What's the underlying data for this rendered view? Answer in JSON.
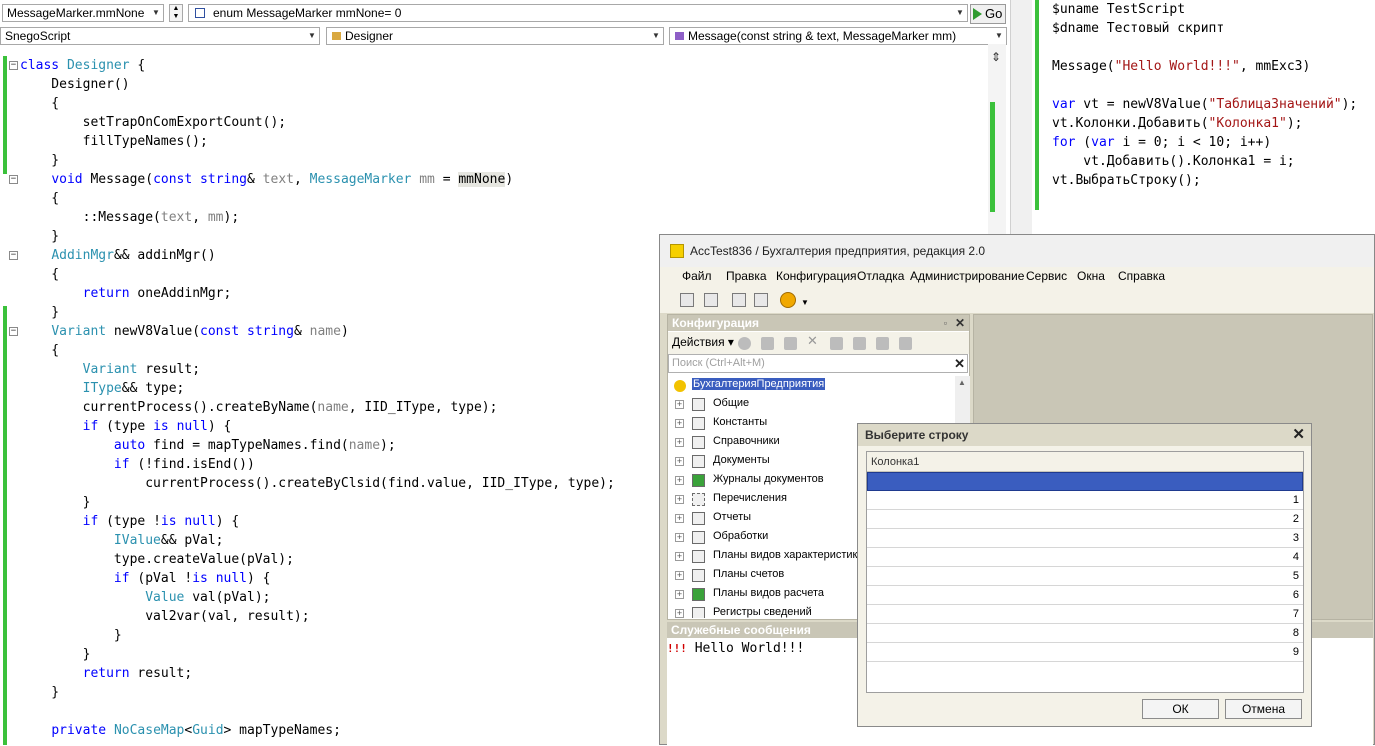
{
  "editor": {
    "nav1": {
      "left": "MessageMarker.mmNone",
      "middle": "enum MessageMarker mmNone= 0",
      "go": "Go"
    },
    "nav2": {
      "left": "SnegoScript",
      "middle": "Designer",
      "right": "Message(const string & text, MessageMarker mm)"
    }
  },
  "script": {
    "lines": [
      [
        "$uname TestScript"
      ],
      [
        "$dname Тестовый скрипт"
      ],
      [
        ""
      ],
      [
        "Message(",
        "\"Hello World!!!\"",
        ", mmExc3)"
      ],
      [
        ""
      ],
      [
        "var",
        " vt = newV8Value(",
        "\"ТаблицаЗначений\"",
        ");"
      ],
      [
        "vt.Колонки.Добавить(",
        "\"Колонка1\"",
        ");"
      ],
      [
        "for",
        " (",
        "var",
        " i = 0; i < 10; i++)"
      ],
      [
        "    vt.Добавить().Колонка1 = i;"
      ],
      [
        "vt.ВыбратьСтроку();"
      ]
    ]
  },
  "win1c": {
    "title": "AccTest836 / Бухгалтерия предприятия, редакция 2.0",
    "menu": [
      "Файл",
      "Правка",
      "Конфигурация",
      "Отладка",
      "Администрирование",
      "Сервис",
      "Окна",
      "Справка"
    ],
    "config_panel": {
      "title": "Конфигурация",
      "actions_label": "Действия",
      "search_placeholder": "Поиск (Ctrl+Alt+M)",
      "tree": [
        "БухгалтерияПредприятия",
        "Общие",
        "Константы",
        "Справочники",
        "Документы",
        "Журналы документов",
        "Перечисления",
        "Отчеты",
        "Обработки",
        "Планы видов характеристик",
        "Планы счетов",
        "Планы видов расчета",
        "Регистры сведений"
      ]
    },
    "messages": {
      "title": "Служебные сообщения",
      "marker": "!!!",
      "text": "Hello World!!!"
    }
  },
  "dialog": {
    "title": "Выберите строку",
    "column": "Колонка1",
    "rows": [
      "",
      "1",
      "2",
      "3",
      "4",
      "5",
      "6",
      "7",
      "8",
      "9"
    ],
    "ok": "ОК",
    "cancel": "Отмена"
  },
  "icons": [
    "close-icon",
    "pin-icon",
    "dropdown-arrow-icon",
    "fold-minus-icon",
    "expand-plus-icon",
    "go-arrow-icon",
    "1c-logo-icon"
  ],
  "colors": {
    "selection": "#3a5dbf",
    "changebar": "#3bc13b",
    "keyword": "#0000ff",
    "type": "#2b91af",
    "string": "#a31515",
    "param": "#808080"
  }
}
